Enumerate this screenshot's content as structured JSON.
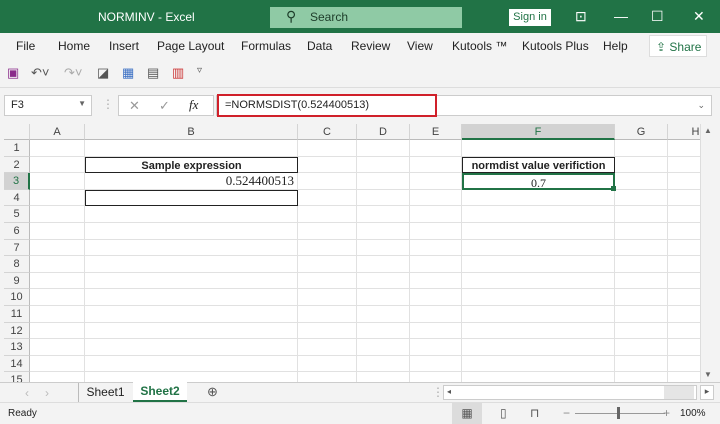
{
  "titlebar": {
    "title": "NORMINV  -  Excel",
    "search_placeholder": "Search",
    "sign_in": "Sign in"
  },
  "menu": [
    "File",
    "Home",
    "Insert",
    "Page Layout",
    "Formulas",
    "Data",
    "Review",
    "View",
    "Kutools ™",
    "Kutools Plus",
    "Help"
  ],
  "share": "Share",
  "formula_bar": {
    "name_box": "F3",
    "formula": "=NORMSDIST(0.524400513)"
  },
  "columns": [
    "A",
    "B",
    "C",
    "D",
    "E",
    "F",
    "G",
    "H"
  ],
  "rows": [
    "1",
    "2",
    "3",
    "4",
    "5",
    "6",
    "7",
    "8",
    "9",
    "10",
    "11",
    "12",
    "13",
    "14",
    "15"
  ],
  "cells": {
    "B2": "Sample expression",
    "B3": "0.524400513",
    "F2": "normdist value verifiction",
    "F3": "0.7"
  },
  "sheets": [
    "Sheet1",
    "Sheet2"
  ],
  "active_sheet": "Sheet2",
  "status": {
    "text": "Ready",
    "zoom": "100%"
  },
  "colors": {
    "brand": "#217346",
    "highlight": "#d0202a"
  }
}
